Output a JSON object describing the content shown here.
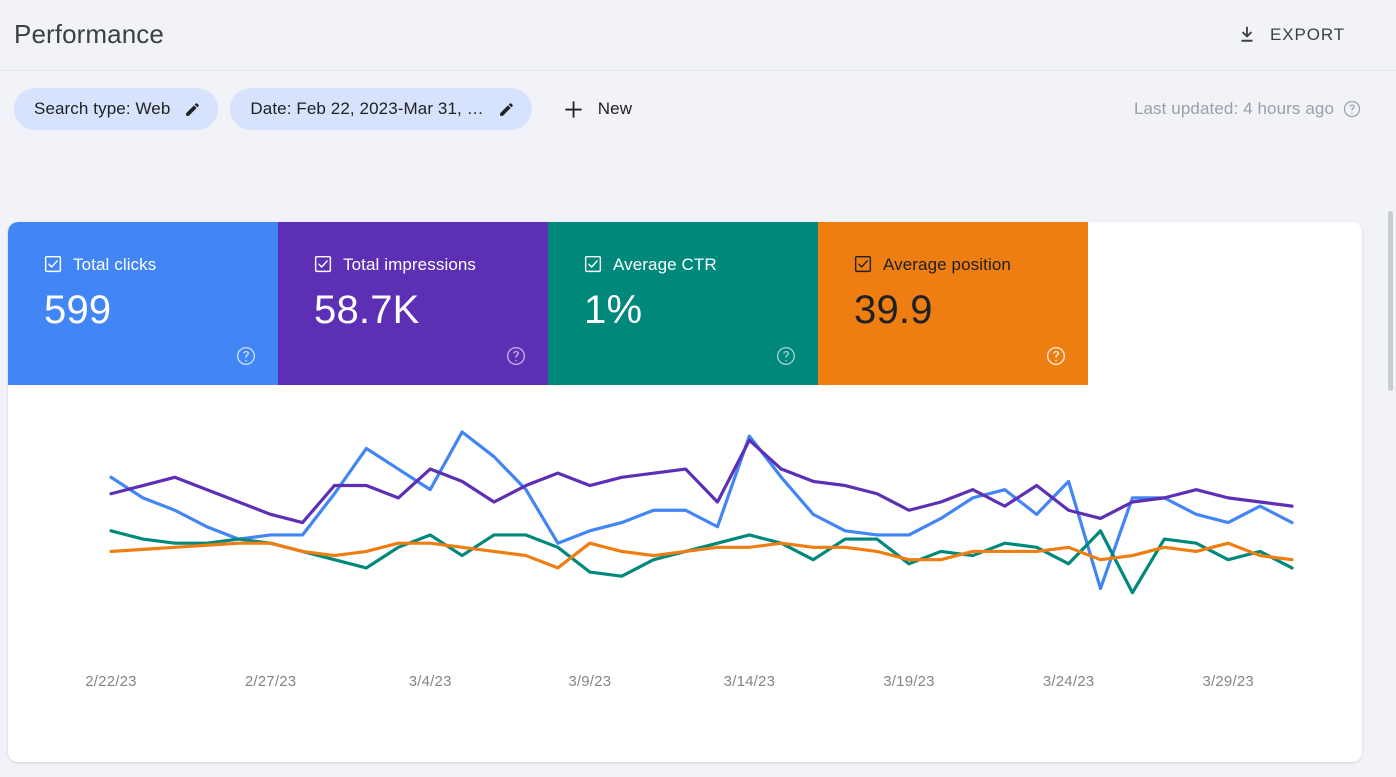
{
  "header": {
    "title": "Performance",
    "export_label": "EXPORT",
    "export_icon": "download-icon"
  },
  "filters": {
    "chips": [
      {
        "label": "Search type: Web",
        "edit_icon": "pencil-icon"
      },
      {
        "label": "Date: Feb 22, 2023-Mar 31, …",
        "edit_icon": "pencil-icon"
      }
    ],
    "new_label": "New",
    "new_icon": "plus-icon",
    "last_updated": "Last updated: 4 hours ago",
    "last_updated_help_icon": "help-circle-icon"
  },
  "metrics": [
    {
      "label": "Total clicks",
      "value": "599",
      "color": "#4285f4",
      "text_mode": "light",
      "checked": true,
      "help_icon": "help-circle-icon"
    },
    {
      "label": "Total impressions",
      "value": "58.7K",
      "color": "#5c2fb5",
      "text_mode": "light",
      "checked": true,
      "help_icon": "help-circle-icon"
    },
    {
      "label": "Average CTR",
      "value": "1%",
      "color": "#00897b",
      "text_mode": "light",
      "checked": true,
      "help_icon": "help-circle-icon"
    },
    {
      "label": "Average position",
      "value": "39.9",
      "color": "#ee7e11",
      "text_mode": "dark",
      "checked": true,
      "help_icon": "help-circle-icon"
    }
  ],
  "chart_data": {
    "type": "line",
    "title": "",
    "xlabel": "",
    "ylabel": "",
    "grid": false,
    "legend": "none",
    "x": [
      "2/22/23",
      "2/23/23",
      "2/24/23",
      "2/25/23",
      "2/26/23",
      "2/27/23",
      "2/28/23",
      "3/1/23",
      "3/2/23",
      "3/3/23",
      "3/4/23",
      "3/5/23",
      "3/6/23",
      "3/7/23",
      "3/8/23",
      "3/9/23",
      "3/10/23",
      "3/11/23",
      "3/12/23",
      "3/13/23",
      "3/14/23",
      "3/15/23",
      "3/16/23",
      "3/17/23",
      "3/18/23",
      "3/19/23",
      "3/20/23",
      "3/21/23",
      "3/22/23",
      "3/23/23",
      "3/24/23",
      "3/25/23",
      "3/26/23",
      "3/27/23",
      "3/28/23",
      "3/29/23",
      "3/30/23",
      "3/31/23"
    ],
    "tick_labels": [
      "2/22/23",
      "2/27/23",
      "3/4/23",
      "3/9/23",
      "3/14/23",
      "3/19/23",
      "3/24/23",
      "3/29/23"
    ],
    "tick_indices": [
      0,
      5,
      10,
      15,
      20,
      25,
      30,
      35
    ],
    "series": [
      {
        "name": "Total clicks",
        "color": "#4285f4",
        "values": [
          62,
          52,
          46,
          38,
          32,
          34,
          34,
          54,
          76,
          66,
          56,
          84,
          72,
          56,
          30,
          36,
          40,
          46,
          46,
          38,
          82,
          62,
          44,
          36,
          34,
          34,
          42,
          52,
          56,
          44,
          60,
          8,
          52,
          52,
          44,
          40,
          48,
          40
        ]
      },
      {
        "name": "Total impressions",
        "color": "#5c2fb5",
        "values": [
          54,
          58,
          62,
          56,
          50,
          44,
          40,
          58,
          58,
          52,
          66,
          60,
          50,
          58,
          64,
          58,
          62,
          64,
          66,
          50,
          80,
          66,
          60,
          58,
          54,
          46,
          50,
          56,
          48,
          58,
          46,
          42,
          50,
          52,
          56,
          52,
          50,
          48
        ]
      },
      {
        "name": "Average CTR",
        "color": "#00897b",
        "values": [
          36,
          32,
          30,
          30,
          32,
          30,
          26,
          22,
          18,
          28,
          34,
          24,
          34,
          34,
          28,
          16,
          14,
          22,
          26,
          30,
          34,
          30,
          22,
          32,
          32,
          20,
          26,
          24,
          30,
          28,
          20,
          36,
          6,
          32,
          30,
          22,
          26,
          18
        ]
      },
      {
        "name": "Average position",
        "color": "#ee7e11",
        "values": [
          26,
          27,
          28,
          29,
          30,
          30,
          26,
          24,
          26,
          30,
          30,
          28,
          26,
          24,
          18,
          30,
          26,
          24,
          26,
          28,
          28,
          30,
          28,
          28,
          26,
          22,
          22,
          26,
          26,
          26,
          28,
          22,
          24,
          28,
          26,
          30,
          24,
          22
        ]
      }
    ],
    "ylim": [
      0,
      100
    ],
    "y_axis_visible": false
  }
}
